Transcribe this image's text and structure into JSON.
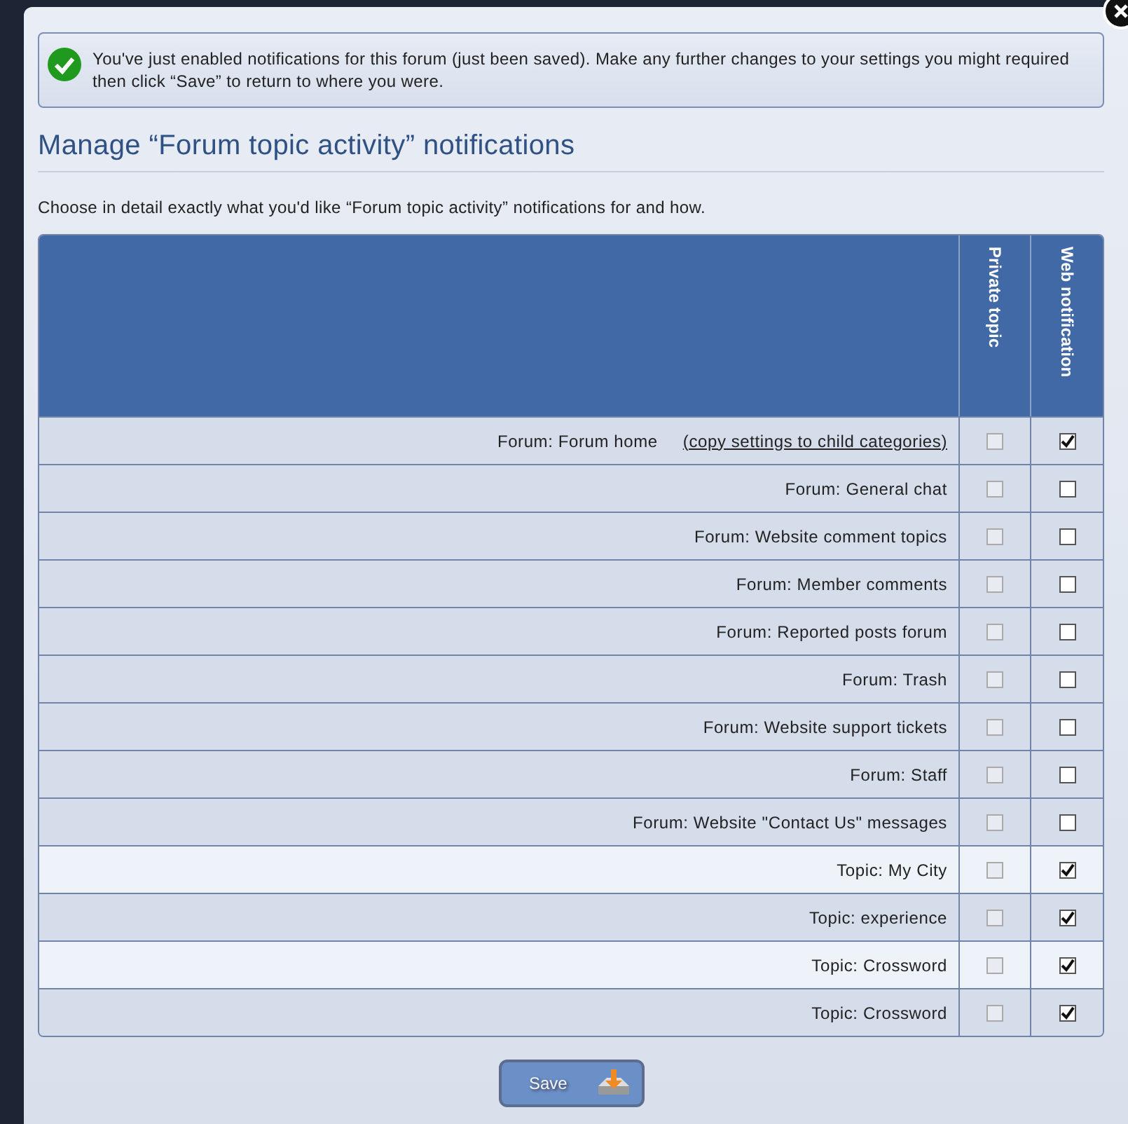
{
  "message": {
    "text": "You've just enabled notifications for this forum (just been saved). Make any further changes to your settings you might required then click “Save” to return to where you were."
  },
  "heading": "Manage “Forum topic activity” notifications",
  "intro": "Choose in detail exactly what you'd like “Forum topic activity” notifications for and how.",
  "table": {
    "columns": [
      "Private topic",
      "Web notification"
    ],
    "rows": [
      {
        "label": "Forum: Forum home",
        "link": "(copy settings to child categories)",
        "highlighted": false,
        "private": {
          "checked": false,
          "disabled": true
        },
        "web": {
          "checked": true,
          "disabled": false
        }
      },
      {
        "label": "Forum: General chat",
        "highlighted": false,
        "private": {
          "checked": false,
          "disabled": true
        },
        "web": {
          "checked": false,
          "disabled": false
        }
      },
      {
        "label": "Forum: Website comment topics",
        "highlighted": false,
        "private": {
          "checked": false,
          "disabled": true
        },
        "web": {
          "checked": false,
          "disabled": false
        }
      },
      {
        "label": "Forum: Member comments",
        "highlighted": false,
        "private": {
          "checked": false,
          "disabled": true
        },
        "web": {
          "checked": false,
          "disabled": false
        }
      },
      {
        "label": "Forum: Reported posts forum",
        "highlighted": false,
        "private": {
          "checked": false,
          "disabled": true
        },
        "web": {
          "checked": false,
          "disabled": false
        }
      },
      {
        "label": "Forum: Trash",
        "highlighted": false,
        "private": {
          "checked": false,
          "disabled": true
        },
        "web": {
          "checked": false,
          "disabled": false
        }
      },
      {
        "label": "Forum: Website support tickets",
        "highlighted": false,
        "private": {
          "checked": false,
          "disabled": true
        },
        "web": {
          "checked": false,
          "disabled": false
        }
      },
      {
        "label": "Forum: Staff",
        "highlighted": false,
        "private": {
          "checked": false,
          "disabled": true
        },
        "web": {
          "checked": false,
          "disabled": false
        }
      },
      {
        "label": "Forum: Website \"Contact Us\" messages",
        "highlighted": false,
        "private": {
          "checked": false,
          "disabled": true
        },
        "web": {
          "checked": false,
          "disabled": false
        }
      },
      {
        "label": "Topic: My City",
        "highlighted": true,
        "private": {
          "checked": false,
          "disabled": true
        },
        "web": {
          "checked": true,
          "disabled": false
        }
      },
      {
        "label": "Topic: experience",
        "highlighted": false,
        "private": {
          "checked": false,
          "disabled": true
        },
        "web": {
          "checked": true,
          "disabled": false
        }
      },
      {
        "label": "Topic: Crossword",
        "highlighted": true,
        "private": {
          "checked": false,
          "disabled": true
        },
        "web": {
          "checked": true,
          "disabled": false
        }
      },
      {
        "label": "Topic: Crossword",
        "highlighted": false,
        "private": {
          "checked": false,
          "disabled": true
        },
        "web": {
          "checked": true,
          "disabled": false
        }
      }
    ]
  },
  "save_button": "Save"
}
